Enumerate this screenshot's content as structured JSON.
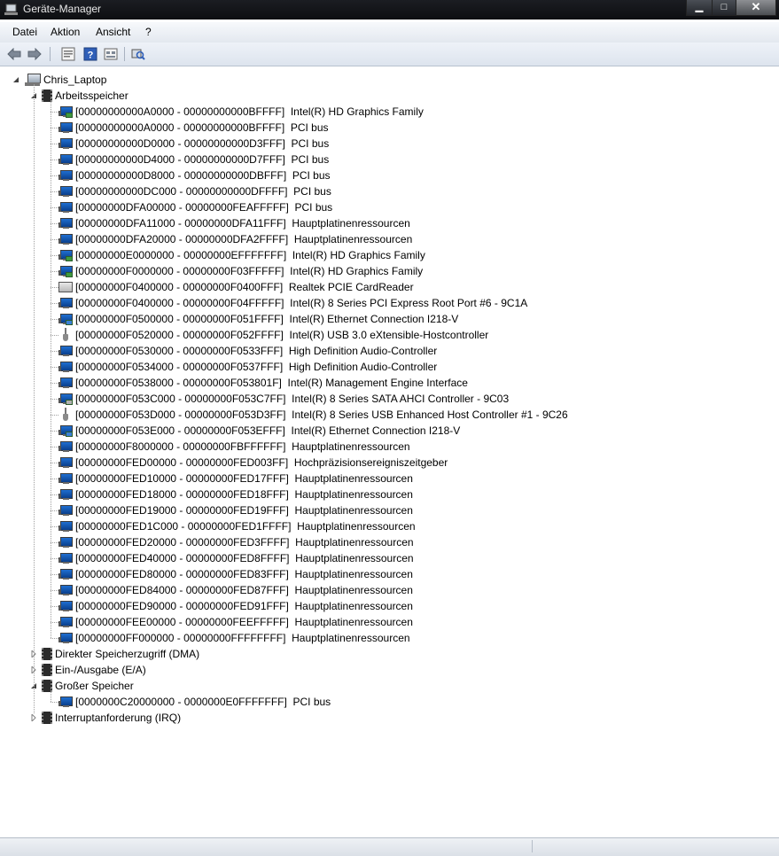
{
  "window": {
    "title": "Geräte-Manager",
    "controls": {
      "minimize": "▁",
      "maximize": "□",
      "close": "✕"
    }
  },
  "menu": [
    "Datei",
    "Aktion",
    "Ansicht",
    "?"
  ],
  "toolbar_icons": [
    "back-arrow-icon",
    "forward-arrow-icon",
    "properties-icon",
    "help-icon",
    "view-icon",
    "scan-hardware-icon"
  ],
  "tree": {
    "root": "Chris_Laptop",
    "categories": [
      {
        "label": "Arbeitsspeicher",
        "expanded": true,
        "items": [
          {
            "text": "[00000000000A0000 - 00000000000BFFFF]  Intel(R) HD Graphics Family",
            "icon": "display-adapter-icon"
          },
          {
            "text": "[00000000000A0000 - 00000000000BFFFF]  PCI bus",
            "icon": "system-device-icon"
          },
          {
            "text": "[00000000000D0000 - 00000000000D3FFF]  PCI bus",
            "icon": "system-device-icon"
          },
          {
            "text": "[00000000000D4000 - 00000000000D7FFF]  PCI bus",
            "icon": "system-device-icon"
          },
          {
            "text": "[00000000000D8000 - 00000000000DBFFF]  PCI bus",
            "icon": "system-device-icon"
          },
          {
            "text": "[00000000000DC000 - 00000000000DFFFF]  PCI bus",
            "icon": "system-device-icon"
          },
          {
            "text": "[00000000DFA00000 - 00000000FEAFFFFF]  PCI bus",
            "icon": "system-device-icon"
          },
          {
            "text": "[00000000DFA11000 - 00000000DFA11FFF]  Hauptplatinenressourcen",
            "icon": "system-device-icon"
          },
          {
            "text": "[00000000DFA20000 - 00000000DFA2FFFF]  Hauptplatinenressourcen",
            "icon": "system-device-icon"
          },
          {
            "text": "[00000000E0000000 - 00000000EFFFFFFF]  Intel(R) HD Graphics Family",
            "icon": "display-adapter-icon"
          },
          {
            "text": "[00000000F0000000 - 00000000F03FFFFF]  Intel(R) HD Graphics Family",
            "icon": "display-adapter-icon"
          },
          {
            "text": "[00000000F0400000 - 00000000F0400FFF]  Realtek PCIE CardReader",
            "icon": "card-reader-icon"
          },
          {
            "text": "[00000000F0400000 - 00000000F04FFFFF]  Intel(R) 8 Series PCI Express Root Port #6 - 9C1A",
            "icon": "system-device-icon"
          },
          {
            "text": "[00000000F0500000 - 00000000F051FFFF]  Intel(R) Ethernet Connection I218-V",
            "icon": "network-adapter-icon"
          },
          {
            "text": "[00000000F0520000 - 00000000F052FFFF]  Intel(R) USB 3.0 eXtensible-Hostcontroller",
            "icon": "usb-icon"
          },
          {
            "text": "[00000000F0530000 - 00000000F0533FFF]  High Definition Audio-Controller",
            "icon": "system-device-icon"
          },
          {
            "text": "[00000000F0534000 - 00000000F0537FFF]  High Definition Audio-Controller",
            "icon": "system-device-icon"
          },
          {
            "text": "[00000000F0538000 - 00000000F053801F]  Intel(R) Management Engine Interface",
            "icon": "system-device-icon"
          },
          {
            "text": "[00000000F053C000 - 00000000F053C7FF]  Intel(R) 8 Series SATA AHCI Controller - 9C03",
            "icon": "ide-controller-icon"
          },
          {
            "text": "[00000000F053D000 - 00000000F053D3FF]  Intel(R) 8 Series USB Enhanced Host Controller #1 - 9C26",
            "icon": "usb-icon"
          },
          {
            "text": "[00000000F053E000 - 00000000F053EFFF]  Intel(R) Ethernet Connection I218-V",
            "icon": "network-adapter-icon"
          },
          {
            "text": "[00000000F8000000 - 00000000FBFFFFFF]  Hauptplatinenressourcen",
            "icon": "system-device-icon"
          },
          {
            "text": "[00000000FED00000 - 00000000FED003FF]  Hochpräzisionsereigniszeitgeber",
            "icon": "system-device-icon"
          },
          {
            "text": "[00000000FED10000 - 00000000FED17FFF]  Hauptplatinenressourcen",
            "icon": "system-device-icon"
          },
          {
            "text": "[00000000FED18000 - 00000000FED18FFF]  Hauptplatinenressourcen",
            "icon": "system-device-icon"
          },
          {
            "text": "[00000000FED19000 - 00000000FED19FFF]  Hauptplatinenressourcen",
            "icon": "system-device-icon"
          },
          {
            "text": "[00000000FED1C000 - 00000000FED1FFFF]  Hauptplatinenressourcen",
            "icon": "system-device-icon"
          },
          {
            "text": "[00000000FED20000 - 00000000FED3FFFF]  Hauptplatinenressourcen",
            "icon": "system-device-icon"
          },
          {
            "text": "[00000000FED40000 - 00000000FED8FFFF]  Hauptplatinenressourcen",
            "icon": "system-device-icon"
          },
          {
            "text": "[00000000FED80000 - 00000000FED83FFF]  Hauptplatinenressourcen",
            "icon": "system-device-icon"
          },
          {
            "text": "[00000000FED84000 - 00000000FED87FFF]  Hauptplatinenressourcen",
            "icon": "system-device-icon"
          },
          {
            "text": "[00000000FED90000 - 00000000FED91FFF]  Hauptplatinenressourcen",
            "icon": "system-device-icon"
          },
          {
            "text": "[00000000FEE00000 - 00000000FEEFFFFF]  Hauptplatinenressourcen",
            "icon": "system-device-icon"
          },
          {
            "text": "[00000000FF000000 - 00000000FFFFFFFF]  Hauptplatinenressourcen",
            "icon": "system-device-icon"
          }
        ]
      },
      {
        "label": "Direkter Speicherzugriff (DMA)",
        "expanded": false,
        "items": []
      },
      {
        "label": "Ein-/Ausgabe (E/A)",
        "expanded": false,
        "items": []
      },
      {
        "label": "Großer Speicher",
        "expanded": true,
        "items": [
          {
            "text": "[0000000C20000000 - 0000000E0FFFFFFF]  PCI bus",
            "icon": "system-device-icon"
          }
        ]
      },
      {
        "label": "Interruptanforderung (IRQ)",
        "expanded": false,
        "items": []
      }
    ]
  },
  "colors": {
    "titlebar": "#15171b",
    "selection": "#3399ff",
    "tree_lines": "#a0a0a0"
  }
}
